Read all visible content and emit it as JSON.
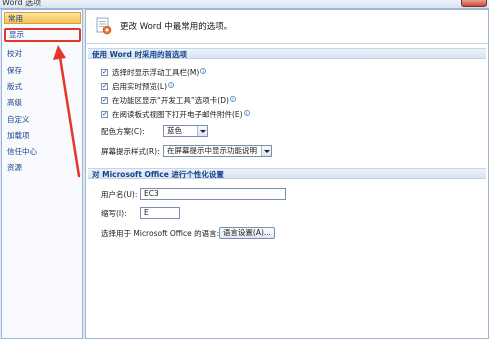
{
  "window": {
    "title": "Word 选项"
  },
  "colors": {
    "annotation": "#e3372b",
    "selected_bg": "#f7c24f",
    "accent": "#15428b"
  },
  "sidebar": {
    "items": [
      {
        "label": "常用",
        "state": "selected"
      },
      {
        "label": "显示",
        "state": "highlighted"
      },
      {
        "label": "校对"
      },
      {
        "label": "保存"
      },
      {
        "label": "版式"
      },
      {
        "label": "高级"
      },
      {
        "label": "自定义"
      },
      {
        "label": "加载项"
      },
      {
        "label": "信任中心"
      },
      {
        "label": "资源"
      }
    ]
  },
  "banner": {
    "text": "更改 Word 中最常用的选项。",
    "icon": "options-icon"
  },
  "section1": {
    "title": "使用 Word 时采用的首选项",
    "options": [
      {
        "label": "选择时显示浮动工具栏(M)",
        "checked": true
      },
      {
        "label": "启用实时预览(L)",
        "checked": true
      },
      {
        "label": "在功能区显示“开发工具”选项卡(D)",
        "checked": true
      },
      {
        "label": "在阅读板式视图下打开电子邮件附件(E)",
        "checked": true
      }
    ],
    "color_scheme": {
      "label": "配色方案(C):",
      "value": "蓝色"
    },
    "screentip": {
      "label": "屏幕提示样式(R):",
      "value": "在屏幕提示中显示功能说明"
    }
  },
  "section2": {
    "title": "对 Microsoft Office 进行个性化设置",
    "username": {
      "label": "用户名(U):",
      "value": "EC3"
    },
    "initials": {
      "label": "缩写(I):",
      "value": "E"
    },
    "language": {
      "label": "选择用于 Microsoft Office 的语言:",
      "button": "语言设置(A)..."
    }
  }
}
